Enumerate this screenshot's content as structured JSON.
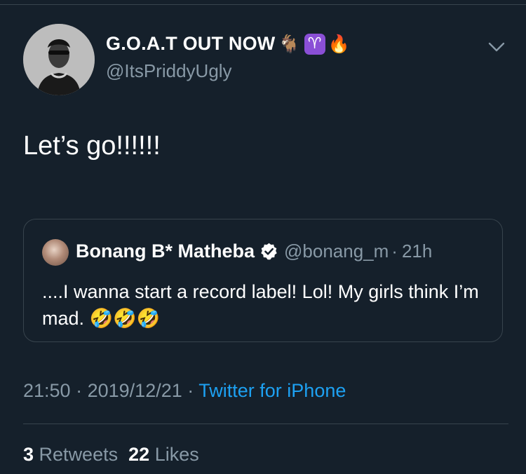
{
  "tweet": {
    "author": {
      "display_name": "G.O.A.T OUT NOW",
      "name_emojis": [
        "🐐",
        "♈",
        "🔥"
      ],
      "handle": "@ItsPriddyUgly"
    },
    "text": "Let’s go!!!!!!",
    "quoted": {
      "display_name": "Bonang B* Matheba",
      "handle": "@bonang_m",
      "separator": "·",
      "time": "21h",
      "text": "....I wanna start a record label! Lol! My girls think I’m mad.",
      "emojis": "🤣🤣🤣"
    },
    "meta": {
      "time": "21:50",
      "separator": "·",
      "date": "2019/12/21",
      "separator2": "·",
      "source": "Twitter for iPhone"
    },
    "stats": {
      "retweets_count": "3",
      "retweets_label": "Retweets",
      "likes_count": "22",
      "likes_label": "Likes"
    }
  },
  "colors": {
    "background": "#15202b",
    "divider": "#38444d",
    "secondary_text": "#8899a6",
    "link": "#1da1f2",
    "verified_badge": "#ffffff"
  },
  "icons": {
    "menu": "chevron-down-icon",
    "verified": "verified-badge-icon"
  }
}
